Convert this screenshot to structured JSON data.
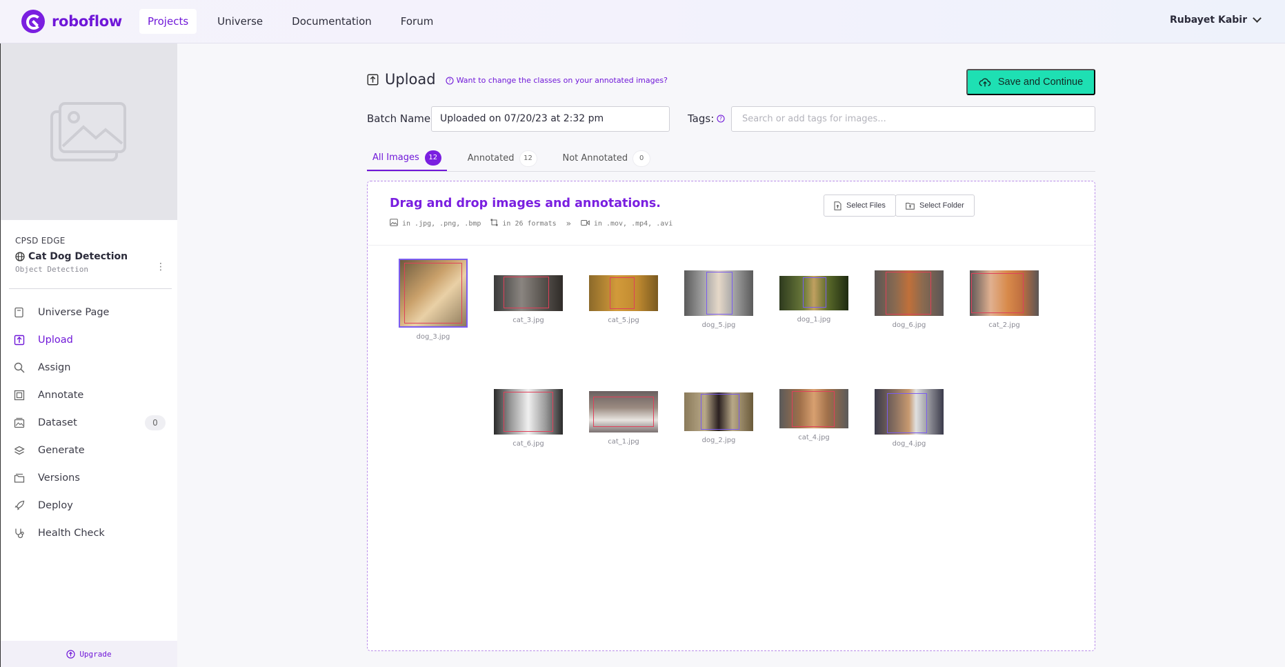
{
  "nav": {
    "brand": "roboflow",
    "links": [
      "Projects",
      "Universe",
      "Documentation",
      "Forum"
    ],
    "user": "Rubayet Kabir"
  },
  "sidebar": {
    "workspace": "CPSD EDGE",
    "project_name": "Cat Dog Detection",
    "project_type": "Object Detection",
    "items": [
      {
        "label": "Universe Page"
      },
      {
        "label": "Upload"
      },
      {
        "label": "Assign"
      },
      {
        "label": "Annotate"
      },
      {
        "label": "Dataset",
        "count": "0"
      },
      {
        "label": "Generate"
      },
      {
        "label": "Versions"
      },
      {
        "label": "Deploy"
      },
      {
        "label": "Health Check"
      }
    ],
    "upgrade": "Upgrade"
  },
  "upload": {
    "title": "Upload",
    "classes_link": "Want to change the classes on your annotated images?",
    "save_button": "Save and Continue",
    "batch_label": "Batch Name:",
    "batch_value": "Uploaded on 07/20/23 at 2:32 pm",
    "tags_label": "Tags:",
    "tags_placeholder": "Search or add tags for images...",
    "tabs": [
      {
        "label": "All Images",
        "count": "12"
      },
      {
        "label": "Annotated",
        "count": "12"
      },
      {
        "label": "Not Annotated",
        "count": "0"
      }
    ],
    "dropzone": {
      "title": "Drag and drop images and annotations.",
      "formats_images": "in .jpg, .png, .bmp",
      "formats_annotations": "in 26 formats",
      "formats_video": "in .mov, .mp4, .avi",
      "select_files": "Select Files",
      "select_folder": "Select Folder"
    },
    "images": [
      "dog_3.jpg",
      "cat_3.jpg",
      "cat_5.jpg",
      "dog_5.jpg",
      "dog_1.jpg",
      "dog_6.jpg",
      "cat_2.jpg",
      "cat_6.jpg",
      "cat_1.jpg",
      "dog_2.jpg",
      "cat_4.jpg",
      "dog_4.jpg"
    ]
  },
  "colors": {
    "accent": "#7a1fe0",
    "save_button": "#1ee0b3"
  }
}
